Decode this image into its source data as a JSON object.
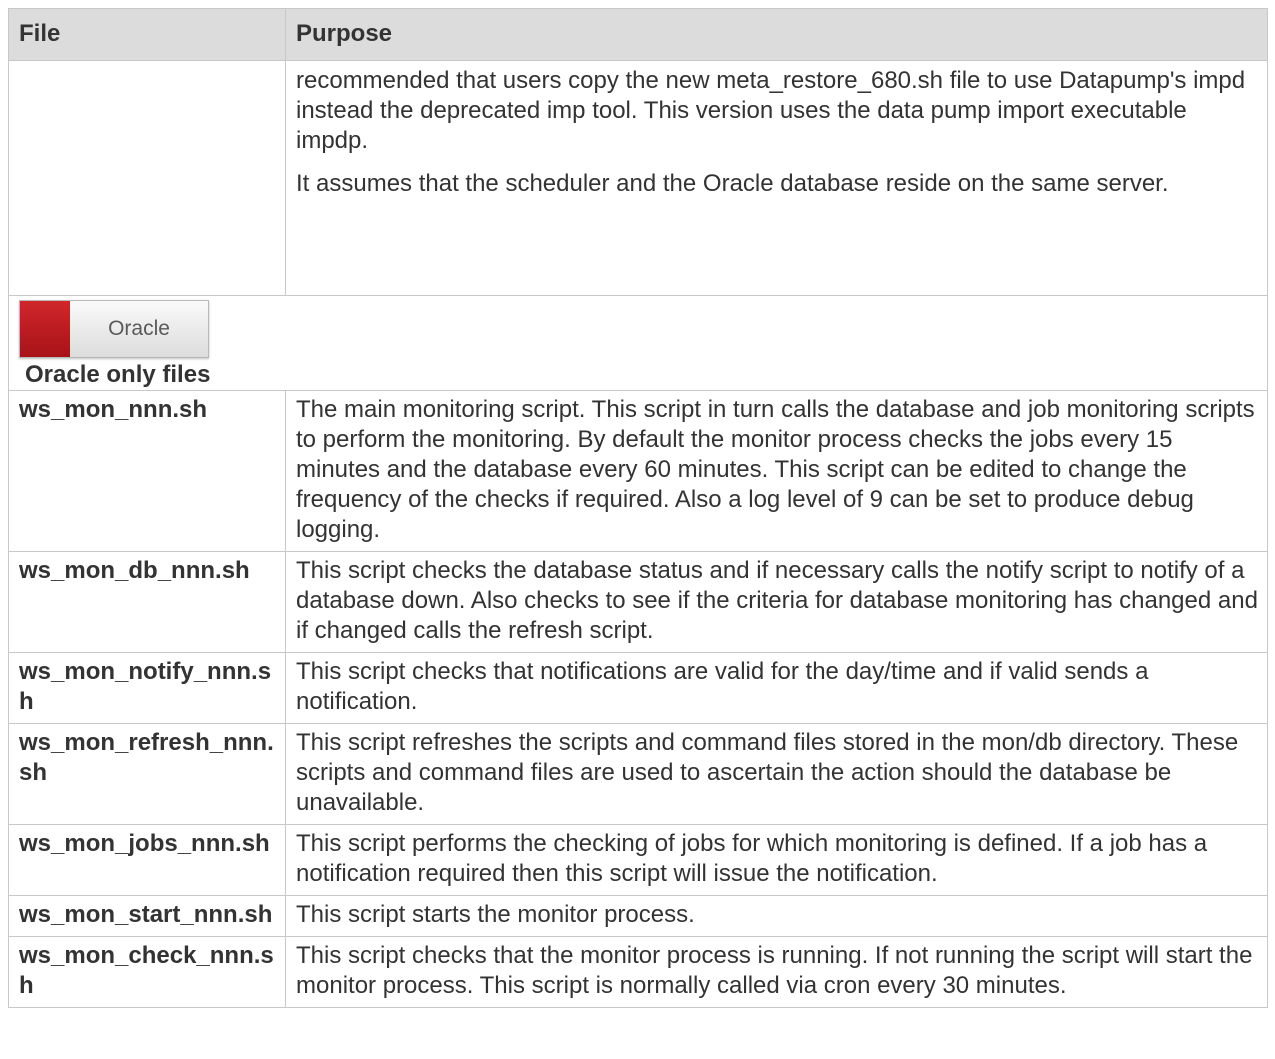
{
  "header": {
    "file": "File",
    "purpose": "Purpose"
  },
  "continued": {
    "para1": "recommended that users copy the new meta_restore_680.sh file to use Datapump's impd instead the deprecated imp tool. This version uses the data pump import executable impdp.",
    "para2": "It assumes that the scheduler and the Oracle database reside on the same server."
  },
  "section": {
    "button_label": "Oracle",
    "button_color": "#c01d22",
    "title": "Oracle only files"
  },
  "rows": [
    {
      "file": "ws_mon_nnn.sh",
      "purpose": "The main monitoring script. This script in turn calls the database and job monitoring scripts to perform the monitoring. By default the monitor process checks the jobs every 15 minutes and the database every 60 minutes. This script can be edited to change the frequency of the checks if required. Also a log level of 9 can be set to produce debug logging."
    },
    {
      "file": "ws_mon_db_nnn.sh",
      "purpose": "This script checks the database status and if necessary calls the notify script to notify of a database down. Also checks to see if the criteria for database monitoring has changed and if changed calls the refresh script."
    },
    {
      "file": "ws_mon_notify_nnn.sh",
      "purpose": "This script checks that notifications are valid for the day/time and if valid sends a notification."
    },
    {
      "file": "ws_mon_refresh_nnn.sh",
      "purpose": "This script refreshes the scripts and command files stored in the mon/db directory. These scripts and command files are used to ascertain the action should the database be unavailable."
    },
    {
      "file": "ws_mon_jobs_nnn.sh",
      "purpose": "This script performs the checking of jobs for which monitoring is defined. If a job has a notification required then this script will issue the notification."
    },
    {
      "file": "ws_mon_start_nnn.sh",
      "purpose": "This script starts the monitor process."
    },
    {
      "file": "ws_mon_check_nnn.sh",
      "purpose": "This script checks that the monitor process is running. If not running the script will start the monitor process. This script is normally called via cron every 30 minutes."
    }
  ]
}
